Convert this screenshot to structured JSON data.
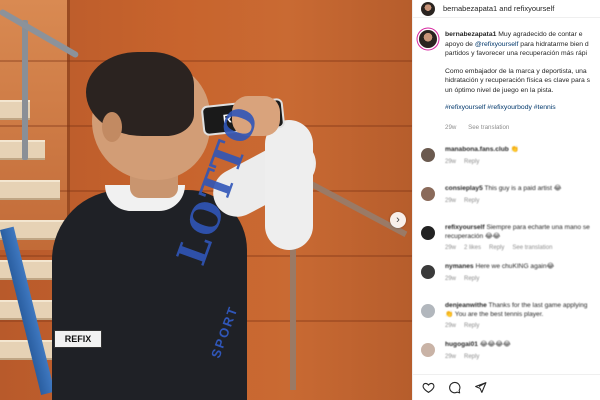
{
  "post": {
    "photo": {
      "can_label": "REFIX",
      "badge_label": "REFIX",
      "shirt_print": "LOTTO",
      "shirt_print_small": "SPORT"
    },
    "header": {
      "text": "bernabezapata1 and refixyourself"
    },
    "caption": {
      "username": "bernabezapata1",
      "paragraph1_before_link": "Muy agradecido de contar e apoyo de",
      "mention": "@refixyourself",
      "paragraph1_after_link": "para hidratarme bien d partidos y favorecer una recuperación más rápi",
      "paragraph2": "Como embajador de la marca y deportista, una hidratación y recuperación física es clave para s un óptimo nivel de juego en la pista.",
      "hashtags": "#refixyourself #refixyourbody #tennis",
      "age": "29w",
      "see_translation": "See translation"
    },
    "comments": [
      {
        "user": "manabona.fans.club",
        "text": "👏",
        "age": "29w",
        "likes": "",
        "reply": "Reply",
        "extra": ""
      },
      {
        "user": "consieplay5",
        "text": "This guy is a paid artist 😂",
        "age": "29w",
        "likes": "",
        "reply": "Reply",
        "extra": ""
      },
      {
        "user": "refixyourself",
        "text": "Siempre para echarte una mano se recuperación 😂😂",
        "age": "29w",
        "likes": "2 likes",
        "reply": "Reply",
        "extra": "See translation"
      },
      {
        "user": "nymanes",
        "text": "Here we chuKING again😂",
        "age": "29w",
        "likes": "",
        "reply": "Reply",
        "extra": ""
      },
      {
        "user": "denjeanwithe",
        "text": "Thanks for the last game applying 👏 You are the best tennis player.",
        "age": "29w",
        "likes": "",
        "reply": "Reply",
        "extra": ""
      },
      {
        "user": "hugogai01",
        "text": "😂😂😂😂",
        "age": "29w",
        "likes": "",
        "reply": "Reply",
        "extra": ""
      }
    ],
    "actions": {
      "like_icon": "heart-icon",
      "comment_icon": "comment-icon",
      "share_icon": "share-icon"
    },
    "next_arrow": "›"
  }
}
